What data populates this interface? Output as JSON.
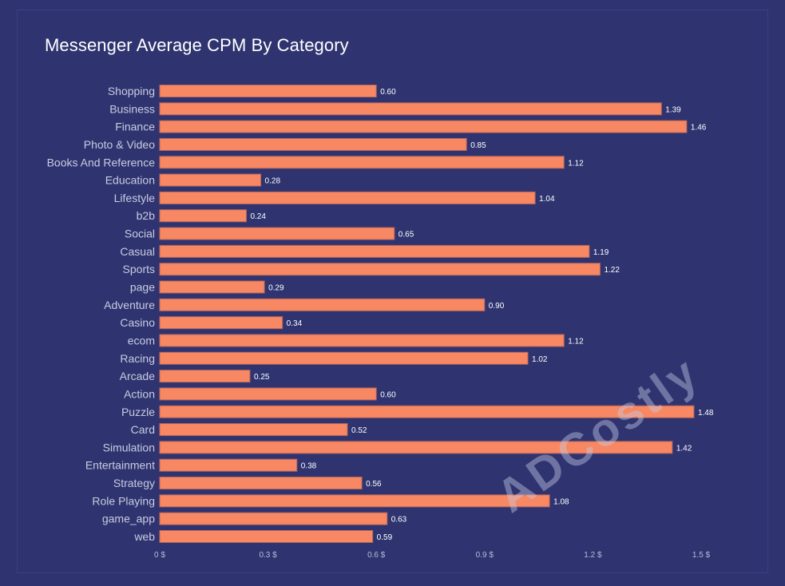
{
  "chart_data": {
    "type": "bar",
    "orientation": "horizontal",
    "title": "Messenger Average CPM By Category",
    "xlabel": "",
    "ylabel": "",
    "xlim": [
      0,
      1.5
    ],
    "x_ticks": [
      0,
      0.3,
      0.6,
      0.9,
      1.2,
      1.5
    ],
    "x_tick_labels": [
      "0 $",
      "0.3 $",
      "0.6 $",
      "0.9 $",
      "1.2 $",
      "1.5 $"
    ],
    "grid": false,
    "legend": "none",
    "categories": [
      "Shopping",
      "Business",
      "Finance",
      "Photo & Video",
      "Books And Reference",
      "Education",
      "Lifestyle",
      "b2b",
      "Social",
      "Casual",
      "Sports",
      "page",
      "Adventure",
      "Casino",
      "ecom",
      "Racing",
      "Arcade",
      "Action",
      "Puzzle",
      "Card",
      "Simulation",
      "Entertainment",
      "Strategy",
      "Role Playing",
      "game_app",
      "web"
    ],
    "values": [
      0.6,
      1.39,
      1.46,
      0.85,
      1.12,
      0.28,
      1.04,
      0.24,
      0.65,
      1.19,
      1.22,
      0.29,
      0.9,
      0.34,
      1.12,
      1.02,
      0.25,
      0.6,
      1.48,
      0.52,
      1.42,
      0.38,
      0.56,
      1.08,
      0.63,
      0.59
    ],
    "value_labels": [
      "0.60",
      "1.39",
      "1.46",
      "0.85",
      "1.12",
      "0.28",
      "1.04",
      "0.24",
      "0.65",
      "1.19",
      "1.22",
      "0.29",
      "0.90",
      "0.34",
      "1.12",
      "1.02",
      "0.25",
      "0.60",
      "1.48",
      "0.52",
      "1.42",
      "0.38",
      "0.56",
      "1.08",
      "0.63",
      "0.59"
    ],
    "colors": {
      "bar": "#f78863",
      "background": "#2f3470"
    },
    "watermark": "ADCostly"
  }
}
